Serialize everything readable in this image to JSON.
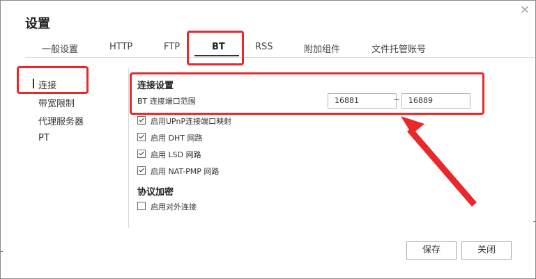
{
  "dialog": {
    "title": "设置",
    "close_glyph": "×"
  },
  "tabs": [
    {
      "label": "一般设置"
    },
    {
      "label": "HTTP"
    },
    {
      "label": "FTP"
    },
    {
      "label": "BT",
      "active": true
    },
    {
      "label": "RSS"
    },
    {
      "label": "附加组件"
    },
    {
      "label": "文件托管账号"
    }
  ],
  "sidebar": {
    "items": [
      {
        "label": "连接",
        "selected": true
      },
      {
        "label": "带宽限制"
      },
      {
        "label": "代理服务器"
      },
      {
        "label": "PT"
      }
    ]
  },
  "connection": {
    "section_title": "连接设置",
    "port_range_label": "BT 连接端口范围",
    "port_from": "16881",
    "port_separator": "~",
    "port_to": "16889",
    "options": [
      {
        "label": "启用UPnP连接端口映射",
        "checked": true
      },
      {
        "label": "启用 DHT 网路",
        "checked": true
      },
      {
        "label": "启用 LSD 网路",
        "checked": true
      },
      {
        "label": "启用 NAT-PMP 网路",
        "checked": true
      }
    ]
  },
  "encryption": {
    "section_title": "协议加密",
    "options": [
      {
        "label": "启用对外连接",
        "checked": false
      }
    ]
  },
  "footer": {
    "save_label": "保存",
    "close_label": "关闭"
  },
  "colors": {
    "annotation": "#e8282a",
    "border": "#b5b5b5",
    "text": "#333333"
  }
}
